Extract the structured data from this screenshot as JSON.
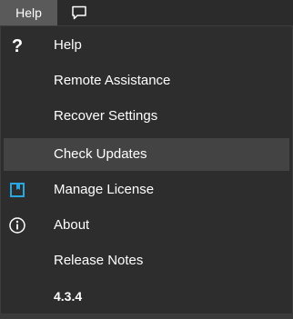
{
  "menubar": {
    "help_label": "Help",
    "chat_icon": "chat-bubble-icon"
  },
  "menu": {
    "items": [
      {
        "label": "Help",
        "icon": "question-mark-icon"
      },
      {
        "label": "Remote Assistance",
        "icon": ""
      },
      {
        "label": "Recover Settings",
        "icon": ""
      },
      {
        "label": "Check Updates",
        "icon": "",
        "hovered": true
      },
      {
        "label": "Manage License",
        "icon": "bookmark-icon",
        "icon_color": "#29a8e0"
      },
      {
        "label": "About",
        "icon": "info-circle-icon"
      },
      {
        "label": "Release Notes",
        "icon": ""
      }
    ],
    "version": "4.3.4"
  },
  "colors": {
    "menu_bg": "#2d2d2d",
    "hover_bg": "#434343",
    "help_tab_bg": "#5a5a5a",
    "accent": "#29a8e0"
  }
}
